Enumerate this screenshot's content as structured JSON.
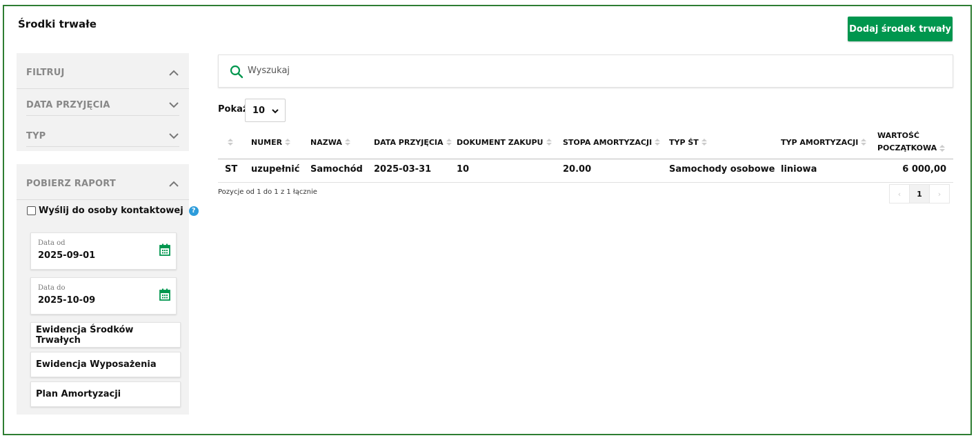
{
  "page": {
    "title": "Środki trwałe",
    "add_button": "Dodaj środek trwały"
  },
  "filter_panel": {
    "header": "FILTRUJ",
    "sections": [
      "DATA PRZYJĘCIA",
      "TYP"
    ]
  },
  "report_panel": {
    "header": "POBIERZ RAPORT",
    "send_checkbox_label": "Wyślij do osoby kontaktowej",
    "help_glyph": "?",
    "date_from": {
      "label": "Data od",
      "value": "2025-09-01"
    },
    "date_to": {
      "label": "Data do",
      "value": "2025-10-09"
    },
    "buttons": [
      "Ewidencja Środków Trwałych",
      "Ewidencja Wyposażenia",
      "Plan Amortyzacji"
    ]
  },
  "search": {
    "placeholder": "Wyszukaj"
  },
  "page_size": {
    "label": "Pokaż",
    "value": "10"
  },
  "table": {
    "columns": [
      "NUMER",
      "NAZWA",
      "DATA PRZYJĘCIA",
      "DOKUMENT ZAKUPU",
      "STOPA AMORTYZACJI",
      "TYP ŚT",
      "TYP AMORTYZACJI",
      "WARTOŚĆ",
      "POCZĄTKOWA"
    ],
    "rows": [
      [
        "ST",
        "uzupełnić",
        "Samochód",
        "2025-03-31",
        "10",
        "20.00",
        "Samochody osobowe",
        "liniowa",
        "6 000,00"
      ]
    ]
  },
  "footer": {
    "info": "Pozycje od 1 do 1 z 1 łącznie",
    "prev": "‹",
    "current_page": "1",
    "next": "›"
  },
  "colors": {
    "accent": "#00964e",
    "frame": "#2e7d32",
    "help": "#2d9cdb"
  }
}
